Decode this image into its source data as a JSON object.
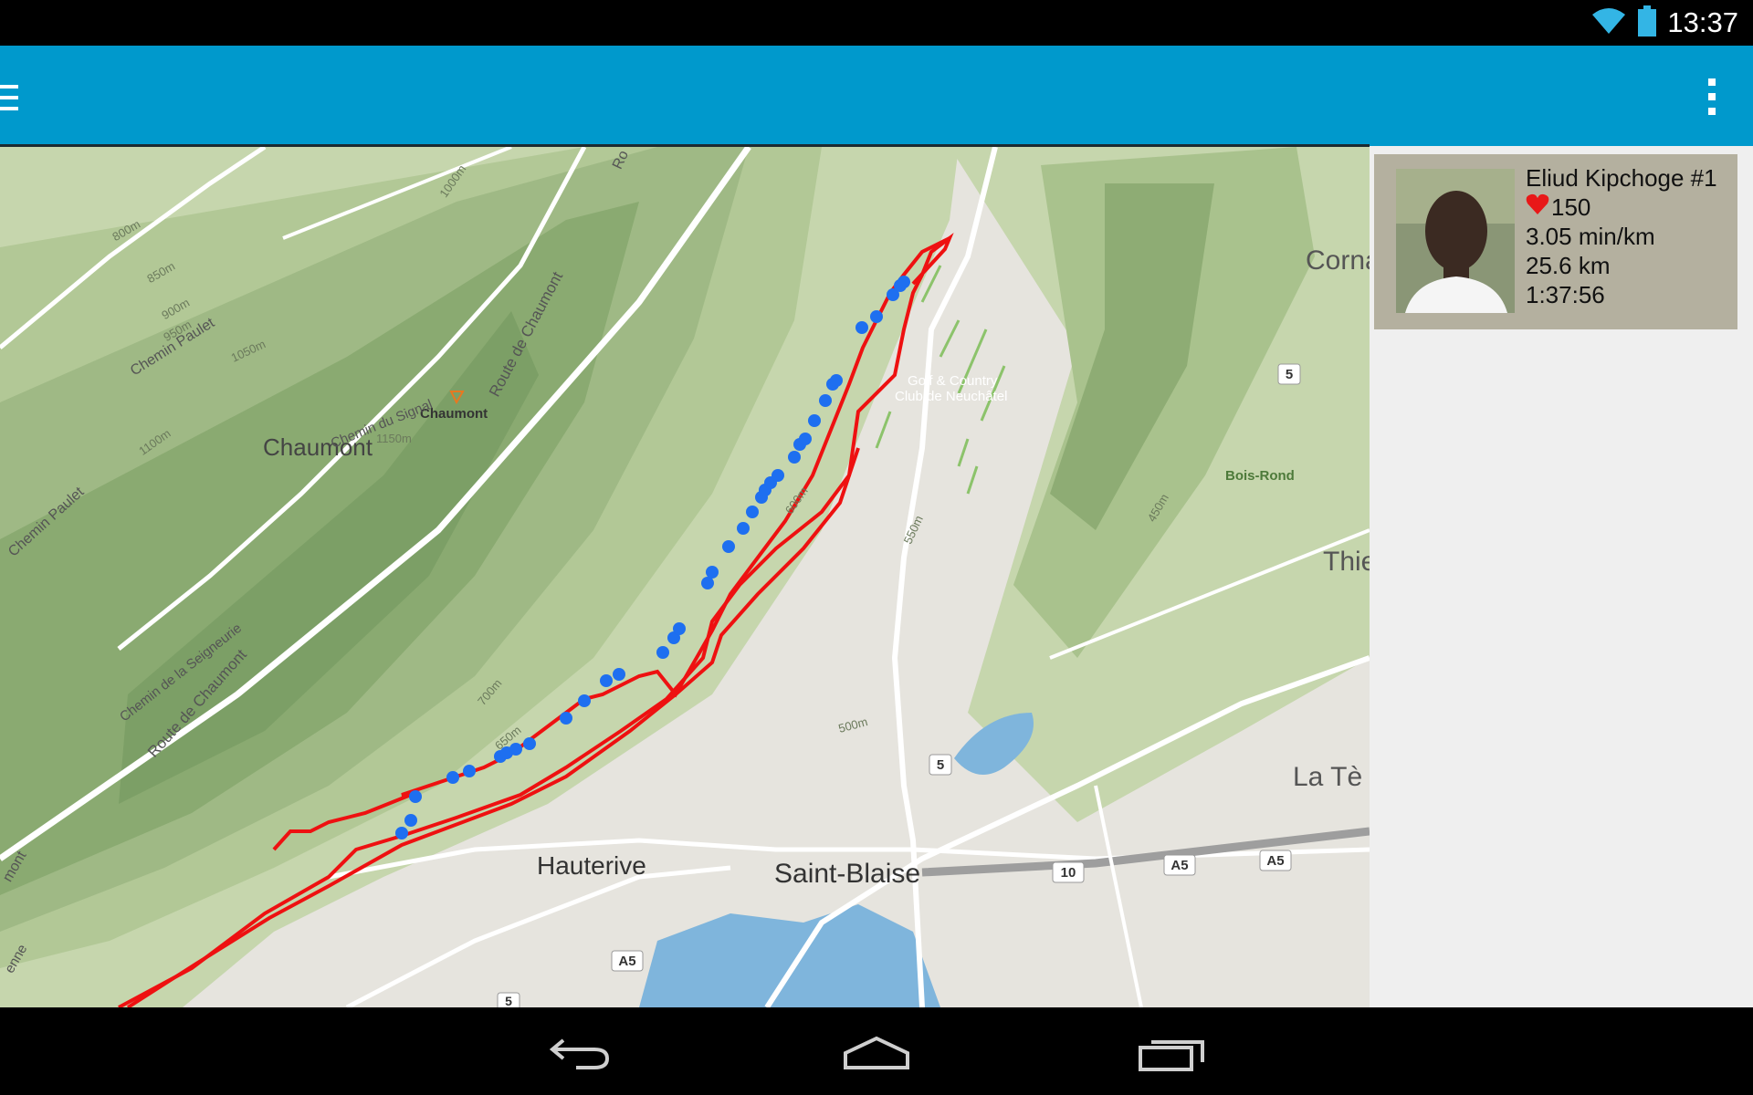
{
  "status_bar": {
    "time": "13:37",
    "wifi_icon": "wifi-icon",
    "battery_icon": "battery-icon"
  },
  "app_bar": {
    "menu_icon": "hamburger-menu-icon",
    "overflow_icon": "overflow-menu-icon",
    "color": "#0099cc"
  },
  "map": {
    "places": {
      "chaumont_big": "Chaumont",
      "chaumont_small": "Chaumont",
      "hauterive": "Hauterive",
      "saint_blaise": "Saint-Blaise",
      "cornaux": "Corna",
      "thielle": "Thie",
      "la_tene": "La Tè",
      "bois_rond": "Bois-Rond",
      "golf_line1": "Golf & Country",
      "golf_line2": "Club de Neuchâtel"
    },
    "roads": {
      "chemin_paulet_1": "Chemin Paulet",
      "chemin_paulet_2": "Chemin Paulet",
      "route_chaumont_1": "Route de Chaumont",
      "route_chaumont_2": "Route de Chaumont",
      "chemin_signal": "Chemin du Signal",
      "chemin_seigneurie": "Chemin de la Seigneurie",
      "mont": "mont",
      "enne": "enne",
      "ro": "Ro"
    },
    "shields": {
      "r5_a": "5",
      "r5_b": "5",
      "r5_c": "5",
      "r10": "10",
      "a5_a": "A5",
      "a5_b": "A5",
      "a5_c": "A5"
    },
    "elevations": {
      "e800": "800m",
      "e850": "850m",
      "e900": "900m",
      "e950": "950m",
      "e1000": "1000m",
      "e1050": "1050m",
      "e1100": "1100m",
      "e1150": "1150m",
      "e650": "650m",
      "e700": "700m",
      "e600": "600m",
      "e550": "550m",
      "e500": "500m",
      "e450": "450m"
    },
    "route_color": "#ee1111",
    "marker_color": "#1e6ff0"
  },
  "runner": {
    "name": "Eliud Kipchoge #1",
    "heart_icon": "heart-icon",
    "heart_rate": "150",
    "pace": "3.05 min/km",
    "distance": "25.6 km",
    "time": "1:37:56"
  },
  "nav": {
    "back_icon": "back-icon",
    "home_icon": "home-icon",
    "recents_icon": "recents-icon"
  }
}
